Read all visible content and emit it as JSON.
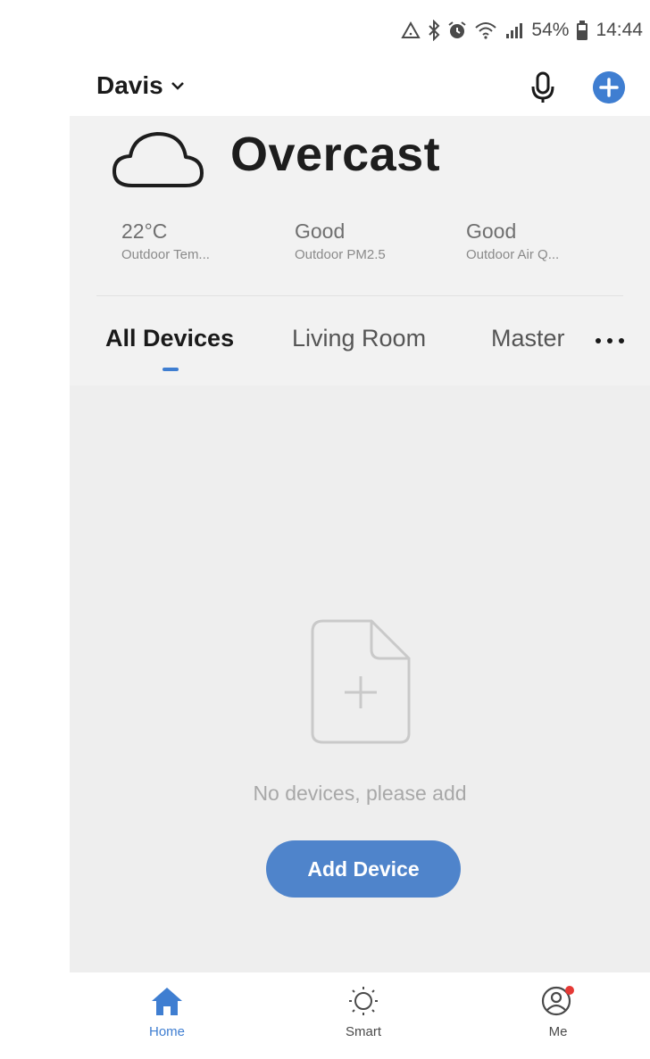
{
  "status_bar": {
    "battery_percent": "54%",
    "time": "14:44"
  },
  "header": {
    "home_name": "Davis"
  },
  "weather": {
    "condition": "Overcast",
    "stats": [
      {
        "value": "22°C",
        "label": "Outdoor Tem..."
      },
      {
        "value": "Good",
        "label": "Outdoor PM2.5"
      },
      {
        "value": "Good",
        "label": "Outdoor Air Q..."
      }
    ]
  },
  "tabs": [
    {
      "label": "All Devices",
      "active": true
    },
    {
      "label": "Living Room",
      "active": false
    },
    {
      "label": "Master",
      "active": false
    }
  ],
  "empty_state": {
    "message": "No devices, please add",
    "button_label": "Add Device"
  },
  "bottom_nav": [
    {
      "label": "Home",
      "icon": "home-icon",
      "active": true
    },
    {
      "label": "Smart",
      "icon": "sun-icon",
      "active": false
    },
    {
      "label": "Me",
      "icon": "profile-icon",
      "active": false
    }
  ],
  "colors": {
    "accent": "#3f7ed1",
    "button": "#4f84cb",
    "notification_dot": "#e53935"
  }
}
